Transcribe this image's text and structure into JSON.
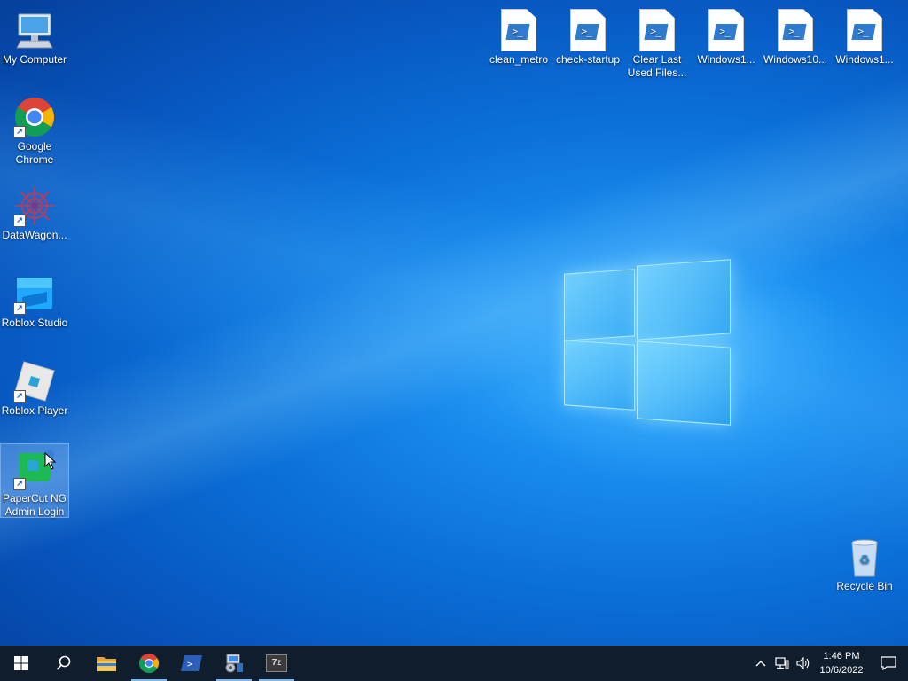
{
  "desktop": {
    "left_icons": [
      {
        "name": "my-computer",
        "label": "My Computer",
        "icon": "computer-icon"
      },
      {
        "name": "google-chrome",
        "label": "Google Chrome",
        "icon": "chrome-icon"
      },
      {
        "name": "datawagon",
        "label": "DataWagon...",
        "icon": "datawagon-icon"
      },
      {
        "name": "roblox-studio",
        "label": "Roblox Studio",
        "icon": "roblox-studio-icon"
      },
      {
        "name": "roblox-player",
        "label": "Roblox Player",
        "icon": "roblox-player-icon"
      },
      {
        "name": "papercut",
        "label": "PaperCut NG Admin Login",
        "icon": "papercut-icon"
      }
    ],
    "top_icons": [
      {
        "label": "clean_metro",
        "icon": "powershell-script-icon"
      },
      {
        "label": "check-startup",
        "icon": "powershell-script-icon"
      },
      {
        "label": "Clear Last Used Files...",
        "icon": "powershell-script-icon"
      },
      {
        "label": "Windows1...",
        "icon": "powershell-script-icon"
      },
      {
        "label": "Windows10...",
        "icon": "powershell-script-icon"
      },
      {
        "label": "Windows1...",
        "icon": "powershell-script-icon"
      }
    ],
    "recycle_bin": {
      "label": "Recycle Bin",
      "icon": "recycle-bin-icon"
    }
  },
  "taskbar": {
    "buttons": [
      {
        "name": "start-button",
        "icon": "windows-logo-icon"
      },
      {
        "name": "search-button",
        "icon": "search-icon"
      },
      {
        "name": "file-explorer-button",
        "icon": "folder-icon"
      },
      {
        "name": "chrome-taskbar-button",
        "icon": "chrome-icon"
      },
      {
        "name": "powershell-taskbar-button",
        "icon": "powershell-icon"
      },
      {
        "name": "settings-app-button",
        "icon": "control-panel-icon"
      },
      {
        "name": "7zip-button",
        "icon": "7zip-icon"
      }
    ],
    "seven_zip_text": "7z",
    "clock": {
      "time": "1:46 PM",
      "date": "10/6/2022"
    },
    "colors": {
      "background": "#0f1d2c",
      "active_indicator": "#7fb6e8"
    }
  }
}
